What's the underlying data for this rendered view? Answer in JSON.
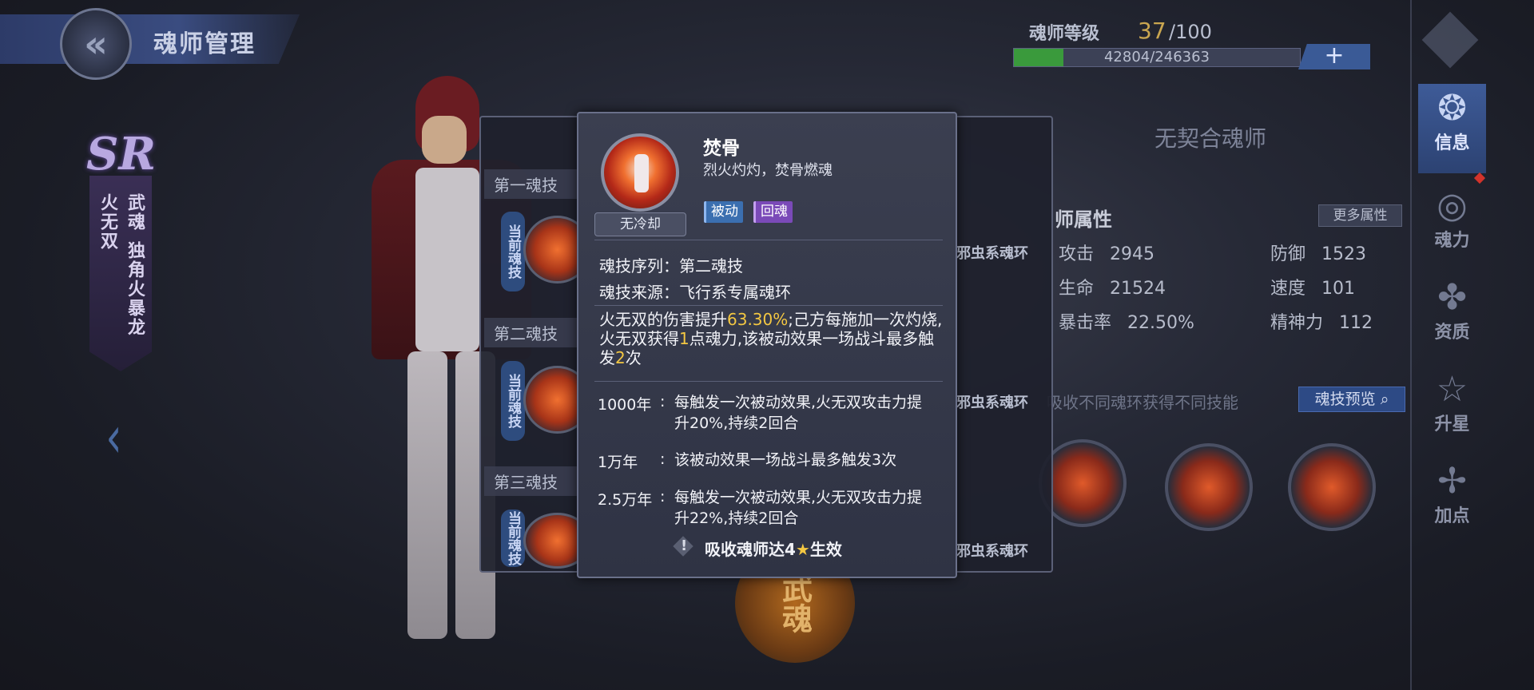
{
  "header": {
    "title": "魂师管理",
    "back_icon": "back-chevron-icon"
  },
  "character": {
    "rarity": "SR",
    "name": "火无双",
    "martial_soul_label": "武魂",
    "martial_soul": "独角火暴龙"
  },
  "level": {
    "label": "魂师等级",
    "current": "37",
    "max": "/100",
    "exp_text": "42804/246363",
    "exp_progress": 0.174,
    "plus": "+"
  },
  "partner": {
    "text": "无契合魂师"
  },
  "attributes": {
    "title": "师属性",
    "more_label": "更多属性",
    "items": [
      {
        "label": "攻击",
        "value": "2945"
      },
      {
        "label": "防御",
        "value": "1523"
      },
      {
        "label": "生命",
        "value": "21524"
      },
      {
        "label": "速度",
        "value": "101"
      },
      {
        "label": "暴击率",
        "value": "22.50%"
      },
      {
        "label": "精神力",
        "value": "112"
      }
    ]
  },
  "ring_section": {
    "note": "吸收不同魂环获得不同技能",
    "preview_label": "魂技预览"
  },
  "nav": [
    {
      "label": "信息",
      "icon": "info-icon"
    },
    {
      "label": "魂力",
      "icon": "soul-power-icon"
    },
    {
      "label": "资质",
      "icon": "aptitude-icon"
    },
    {
      "label": "升星",
      "icon": "star-up-icon"
    },
    {
      "label": "加点",
      "icon": "add-point-icon"
    }
  ],
  "skill_list": {
    "sections": [
      "第一魂技",
      "第二魂技",
      "第三魂技"
    ],
    "current_tag": "当前魂技",
    "ring_tag": "邪虫系魂环"
  },
  "bottom_emblem": "武魂",
  "popup": {
    "name": "焚骨",
    "subtitle": "烈火灼灼，焚骨燃魂",
    "cooldown": "无冷却",
    "tags": [
      "被动",
      "回魂"
    ],
    "sequence_label": "魂技序列：",
    "sequence": "第二魂技",
    "source_label": "魂技来源：",
    "source": "飞行系专属魂环",
    "desc_parts": [
      "火无双的伤害提升",
      "63.30%",
      ";己方每施加一次灼烧,火无双获得",
      "1",
      "点魂力,该被动效果一场战斗最多触发",
      "2",
      "次"
    ],
    "tiers": [
      {
        "year": "1000年",
        "text": "每触发一次被动效果,火无双攻击力提升20%,持续2回合"
      },
      {
        "year": "1万年",
        "text": "该被动效果一场战斗最多触发3次"
      },
      {
        "year": "2.5万年",
        "text": "每触发一次被动效果,火无双攻击力提升22%,持续2回合"
      }
    ],
    "footer_pre": "吸收魂师达4",
    "footer_post": "生效"
  },
  "colors": {
    "accent_blue": "#3a5a96",
    "highlight_gold": "#f3c742",
    "exp_green": "#3a9a3c",
    "tag_passive": "#3b6fb0",
    "tag_return": "#7a4ab8"
  }
}
